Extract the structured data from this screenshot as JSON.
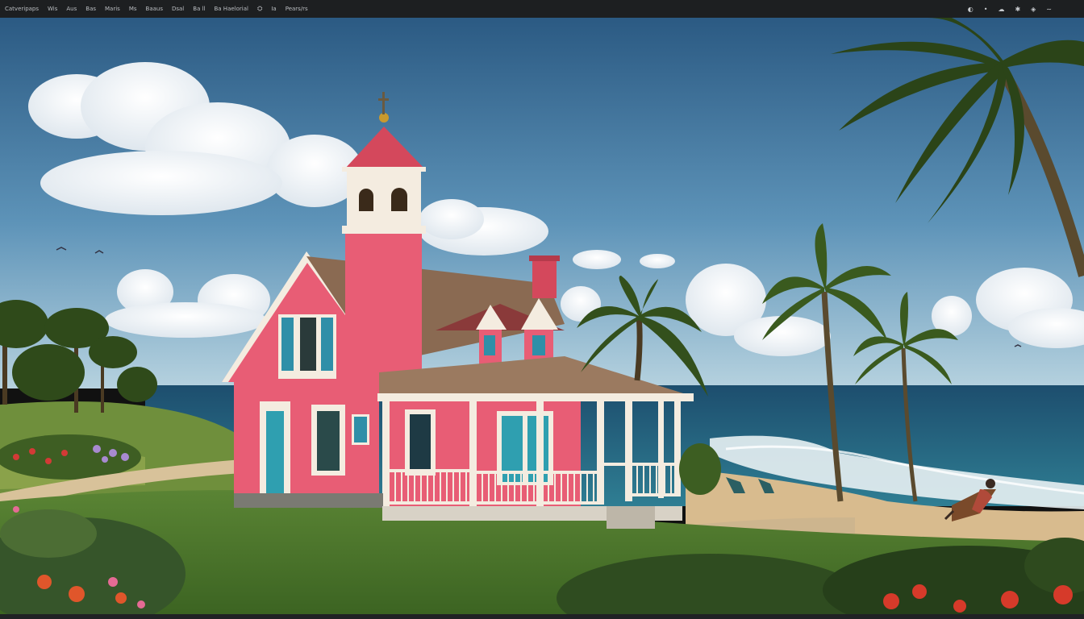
{
  "menubar": {
    "items": [
      "Catveripaps",
      "Wis",
      "Aus",
      "Bas",
      "Maris",
      "Ms",
      "Baaus",
      "Dsal",
      "Ba ll",
      "Ba Haelorial",
      "⛭",
      "Ia",
      "Pears/rs"
    ],
    "tray_icons": [
      "circle-icon",
      "dot-icon",
      "cloud-icon",
      "sparkle-icon",
      "shield-icon",
      "wave-icon"
    ]
  },
  "scene": {
    "description_free": true,
    "palette": {
      "sky_top": "#2e5f86",
      "sky_bottom": "#b9d3e0",
      "ocean": "#1f5a78",
      "sand": "#d9bd92",
      "grass": "#4f7a2c",
      "house_pink": "#e85d75",
      "trim": "#f4ece0",
      "roof": "#8a6a52",
      "shutter": "#2f8fa8"
    }
  }
}
